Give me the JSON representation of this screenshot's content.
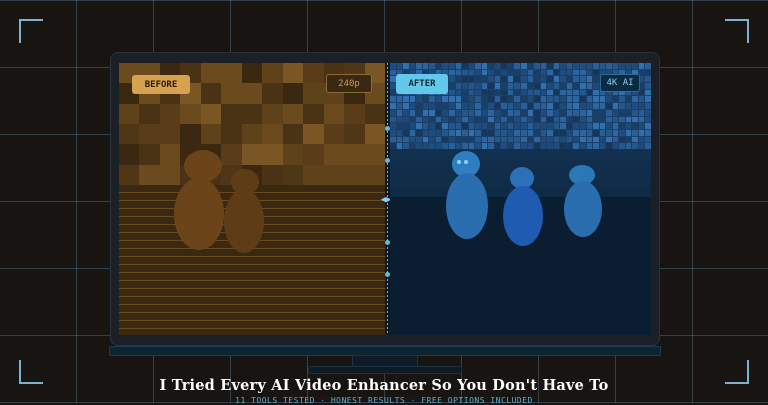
{
  "frame": {
    "accent_color": "#7fb3cc"
  },
  "before_panel": {
    "label": "BEFORE",
    "quality": "240p",
    "tint_color": "#d7a24f"
  },
  "after_panel": {
    "label": "AFTER",
    "quality": "4K AI",
    "tint_color": "#63c8ea"
  },
  "comparison_slider": {
    "icon": "double-chevron-icon",
    "glyph": "◀▶"
  },
  "headline": {
    "title": "I Tried Every AI Video Enhancer So You Don't Have To",
    "subtitle": "11 TOOLS TESTED  ·  HONEST RESULTS  ·  FREE OPTIONS INCLUDED"
  }
}
